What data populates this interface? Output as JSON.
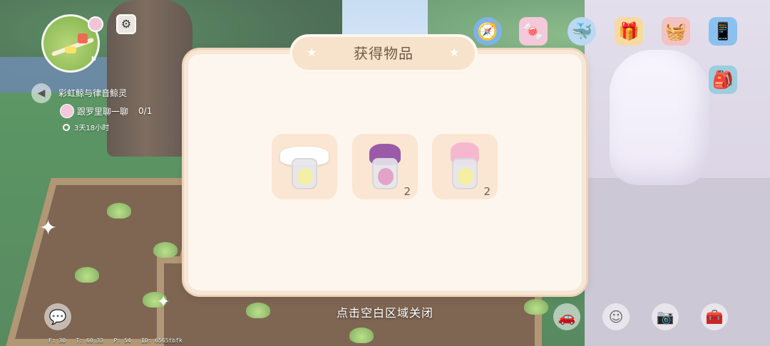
{
  "minimap": {
    "north_label": "N"
  },
  "quest": {
    "title": "彩虹鲸与律音鲸灵",
    "task": "跟罗里聊一聊",
    "progress": "0/1",
    "time_left": "3天18小时"
  },
  "top_icons": [
    "compass-icon",
    "candy-icon",
    "whale-icon",
    "gift-house-icon",
    "shop-basket-icon",
    "phone-icon",
    "backpack-icon"
  ],
  "dialog": {
    "title": "获得物品",
    "items": [
      {
        "name": "cinnamoroll-jar",
        "count": "",
        "cap_color": "#ffffff",
        "fill_color": "#f3f0a6"
      },
      {
        "name": "kuromi-jar",
        "count": "2",
        "cap_color": "#9a5aa8",
        "fill_color": "#e3a3c8"
      },
      {
        "name": "mymelody-jar",
        "count": "2",
        "cap_color": "#f6b8cf",
        "fill_color": "#f6eea0"
      }
    ]
  },
  "close_hint": "点击空白区域关闭",
  "debug": "F: 30   T: 60.33   P: 54   ID: 6565tbfk",
  "bottom_icons": [
    "chat-icon",
    "car-icon",
    "emote-icon",
    "camera-icon",
    "toolbox-icon"
  ]
}
